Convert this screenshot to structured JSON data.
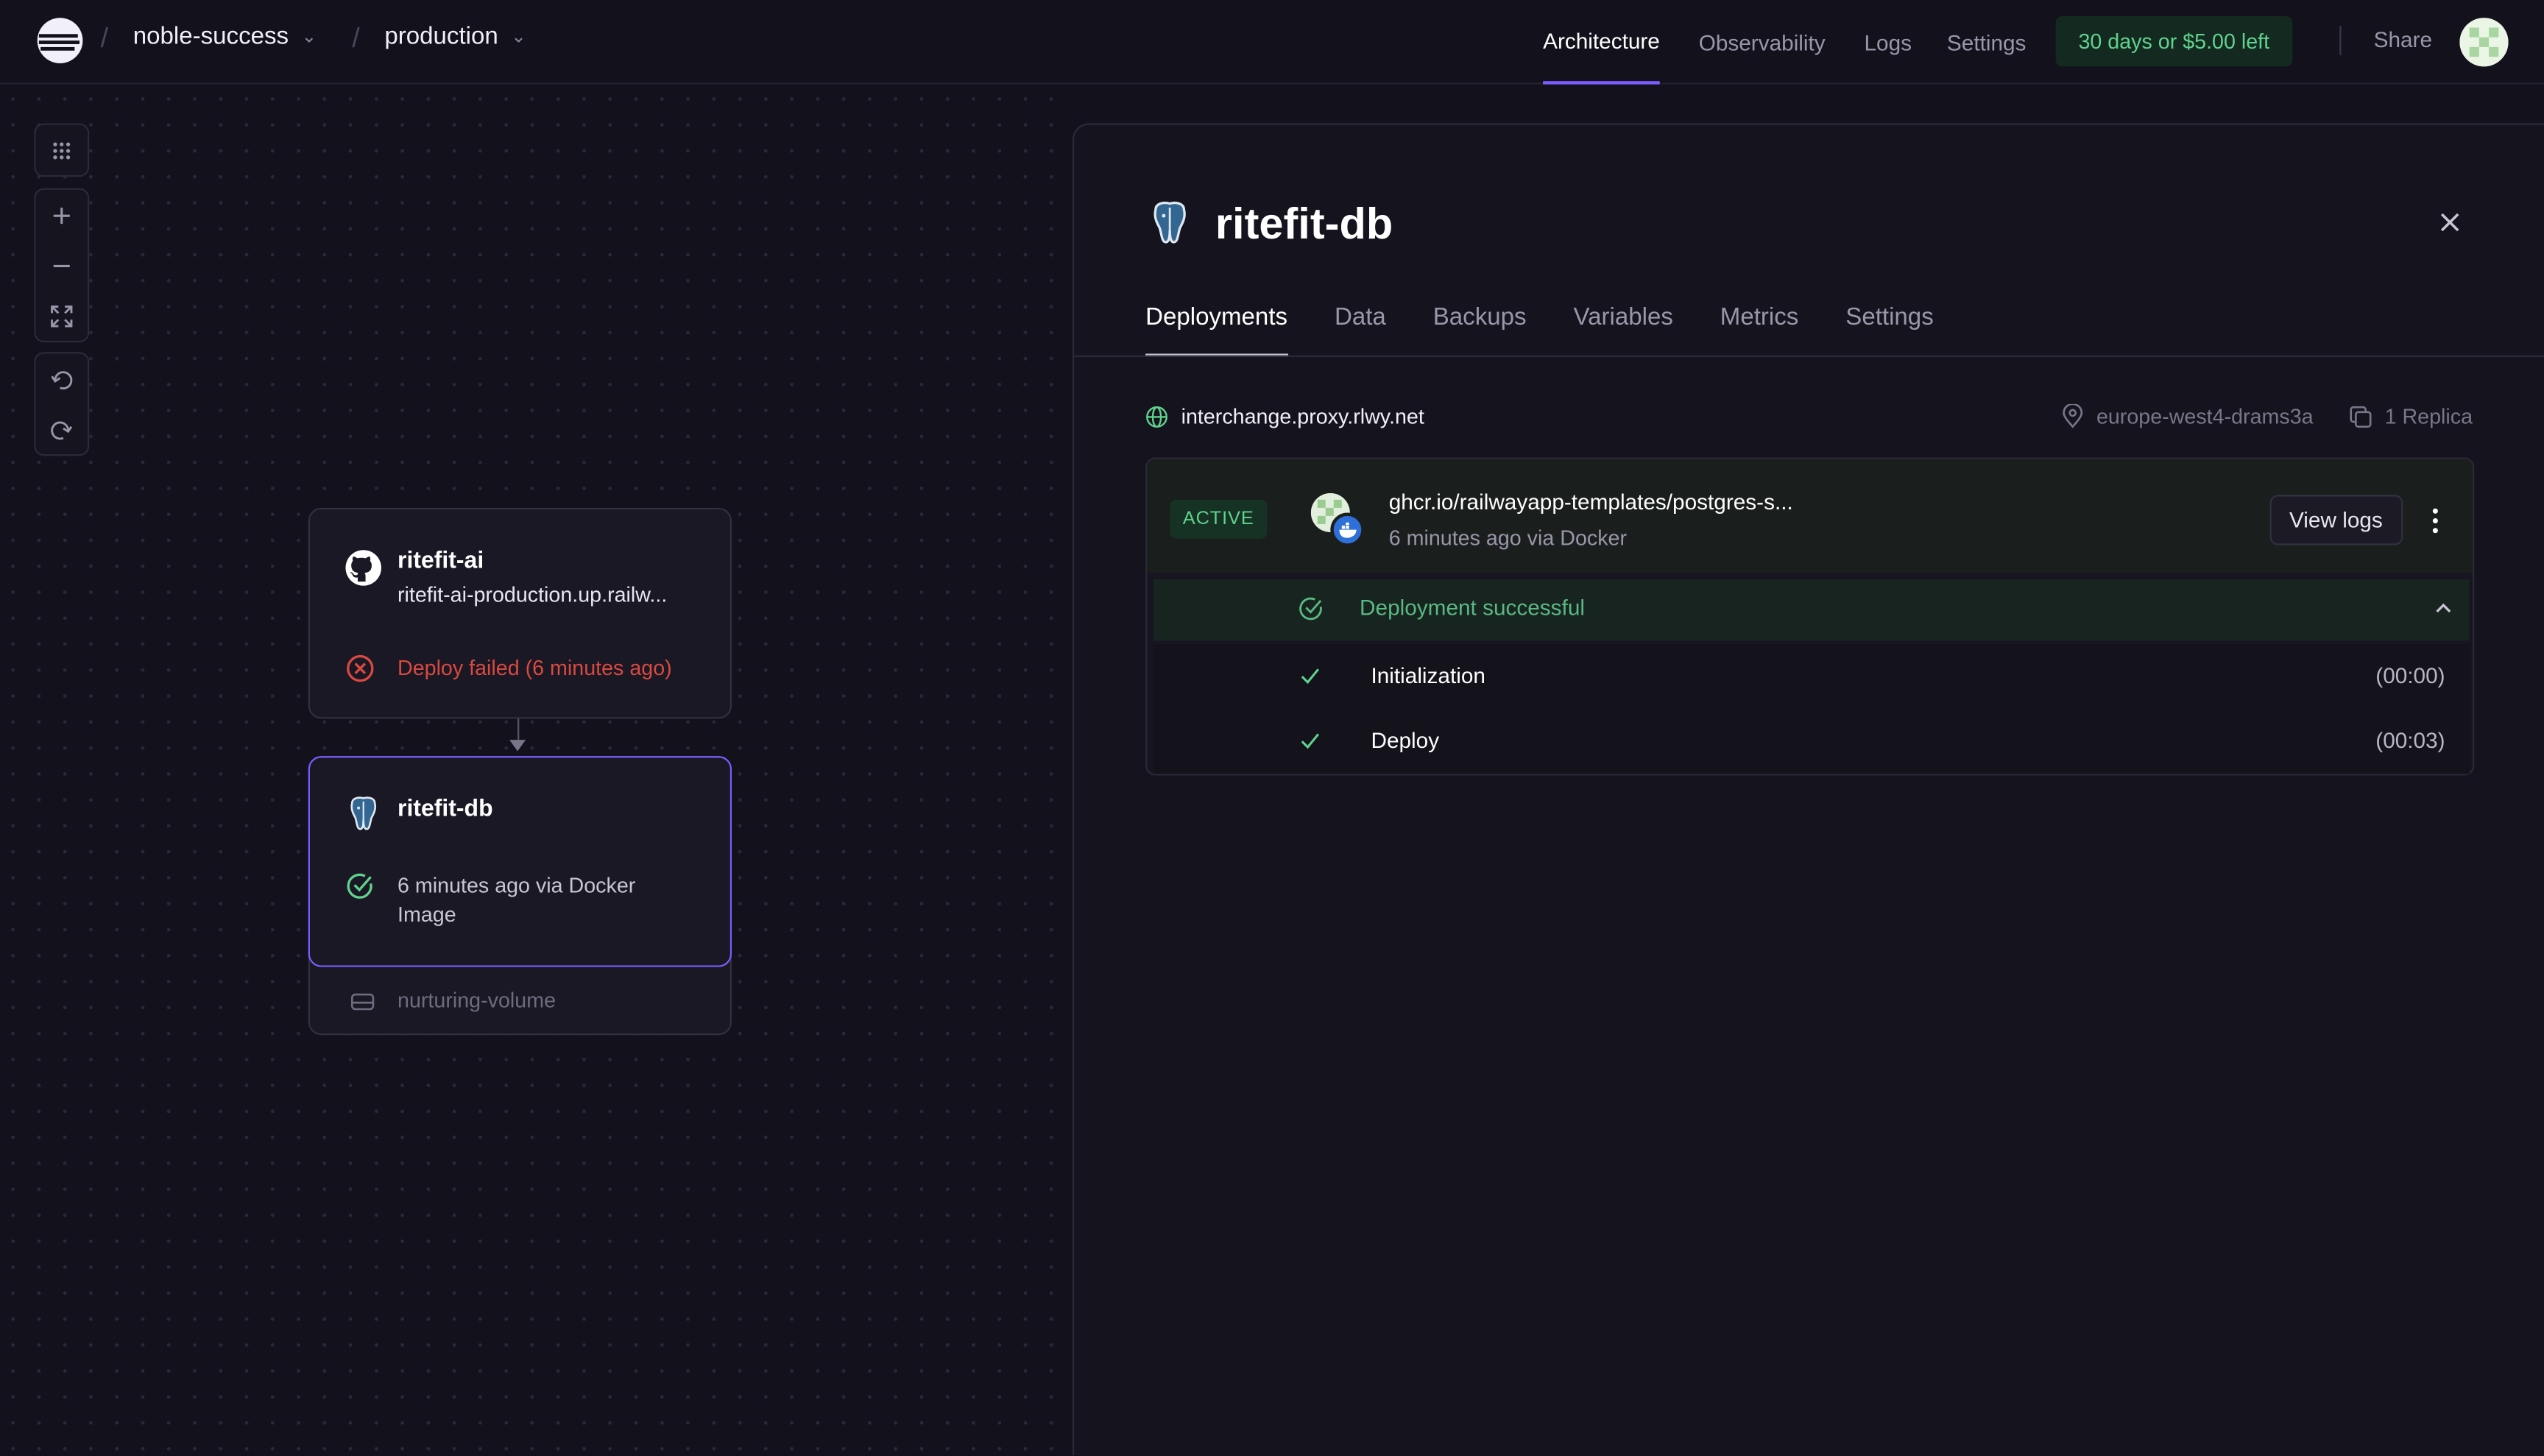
{
  "topbar": {
    "project": "noble-success",
    "environment": "production",
    "nav": [
      "Architecture",
      "Observability",
      "Logs",
      "Settings"
    ],
    "active_nav": "Architecture",
    "trial": "30 days or $5.00 left",
    "share": "Share"
  },
  "canvas": {
    "nodes": [
      {
        "title": "ritefit-ai",
        "subtitle": "ritefit-ai-production.up.railw...",
        "status": "Deploy failed (6 minutes ago)",
        "status_color": "#d9493f",
        "icon": "github-icon"
      },
      {
        "title": "ritefit-db",
        "status": "6 minutes ago via Docker Image",
        "status_color": "#c9c6d4",
        "icon": "postgres-icon",
        "volume": "nurturing-volume"
      }
    ]
  },
  "panel": {
    "title": "ritefit-db",
    "tabs": [
      "Deployments",
      "Data",
      "Backups",
      "Variables",
      "Metrics",
      "Settings"
    ],
    "active_tab": "Deployments",
    "url": "interchange.proxy.rlwy.net",
    "region": "europe-west4-drams3a",
    "replicas": "1 Replica",
    "deployment": {
      "badge": "ACTIVE",
      "image": "ghcr.io/railwayapp-templates/postgres-s...",
      "subtitle": "6 minutes ago via Docker",
      "view_logs": "View logs",
      "status": "Deployment successful",
      "steps": [
        {
          "name": "Initialization",
          "time": "(00:00)"
        },
        {
          "name": "Deploy",
          "time": "(00:03)"
        }
      ]
    }
  },
  "colors": {
    "accent": "#7c5cff",
    "success": "#5fd38d",
    "error": "#d9493f",
    "background": "#13111c"
  }
}
